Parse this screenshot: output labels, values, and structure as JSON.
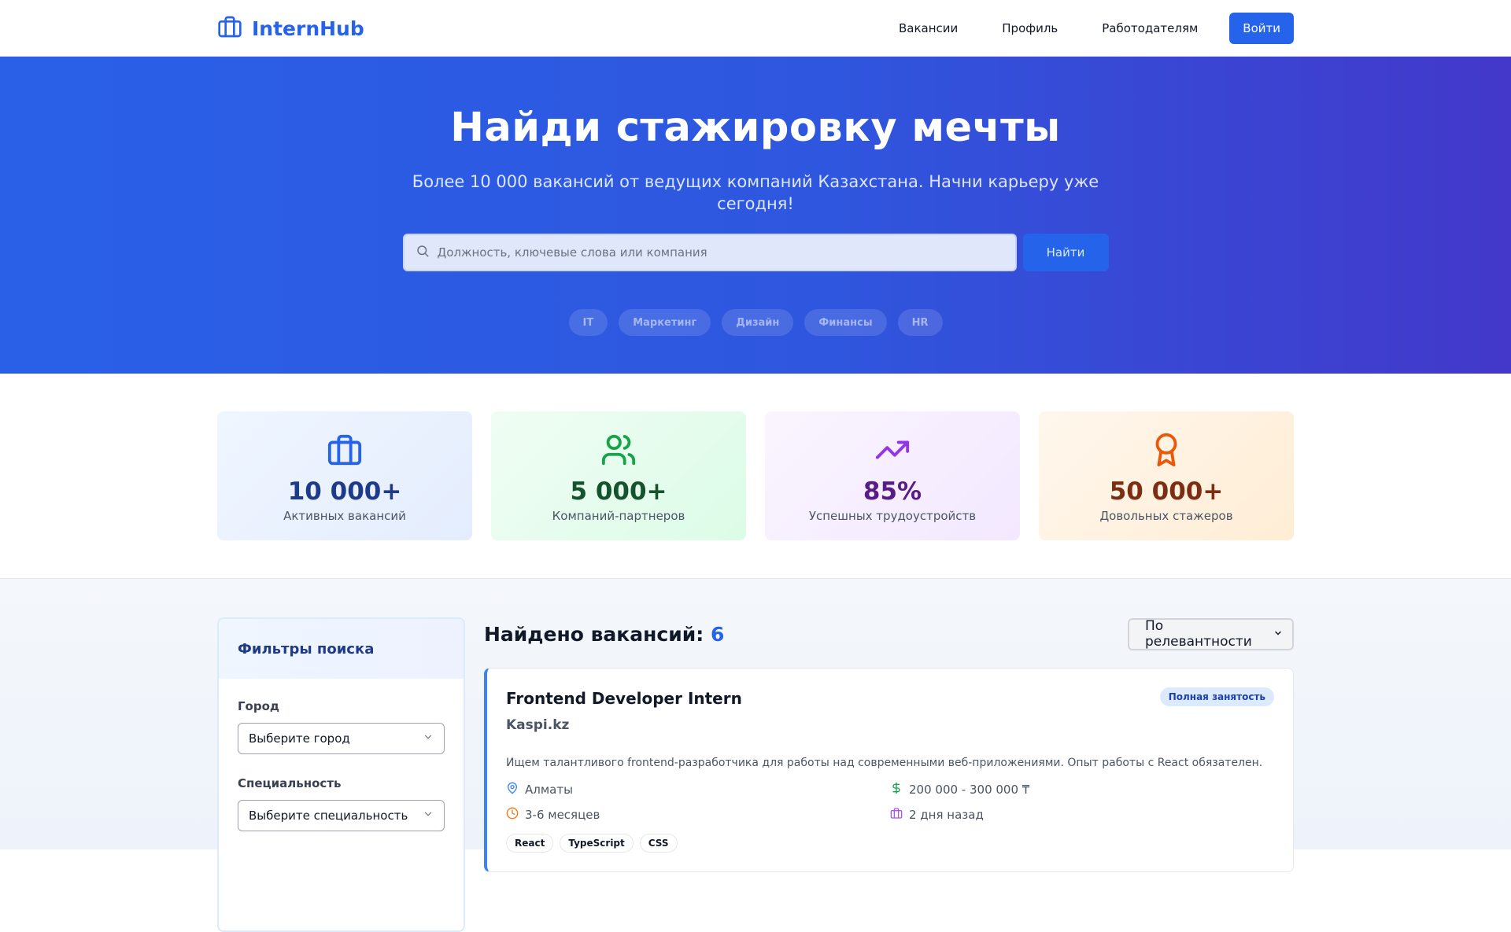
{
  "header": {
    "brand": "InternHub",
    "nav": [
      "Вакансии",
      "Профиль",
      "Работодателям"
    ],
    "login": "Войти"
  },
  "hero": {
    "title": "Найди стажировку мечты",
    "subtitle": "Более 10 000 вакансий от ведущих компаний Казахстана. Начни карьеру уже сегодня!",
    "search_placeholder": "Должность, ключевые слова или компания",
    "search_button": "Найти",
    "chips": [
      "IT",
      "Маркетинг",
      "Дизайн",
      "Финансы",
      "HR"
    ]
  },
  "stats": [
    {
      "value": "10 000+",
      "label": "Активных вакансий",
      "icon": "briefcase-icon",
      "color": "#2563eb"
    },
    {
      "value": "5 000+",
      "label": "Компаний-партнеров",
      "icon": "users-icon",
      "color": "#16a34a"
    },
    {
      "value": "85%",
      "label": "Успешных трудоустройств",
      "icon": "trending-up-icon",
      "color": "#9333ea"
    },
    {
      "value": "50 000+",
      "label": "Довольных стажеров",
      "icon": "award-icon",
      "color": "#ea580c"
    }
  ],
  "filters": {
    "title": "Фильтры поиска",
    "city_label": "Город",
    "city_value": "Выберите город",
    "spec_label": "Специальность",
    "spec_value": "Выберите специальность"
  },
  "results": {
    "title": "Найдено вакансий:",
    "count": "6",
    "sort": "По релевантности"
  },
  "job": {
    "title": "Frontend Developer Intern",
    "company": "Kaspi.kz",
    "badge": "Полная занятость",
    "description": "Ищем талантливого frontend-разработчика для работы над современными веб-приложениями. Опыт работы с React обязателен.",
    "location": "Алматы",
    "salary": "200 000 - 300 000 ₸",
    "duration": "3-6 месяцев",
    "posted": "2 дня назад",
    "tags": [
      "React",
      "TypeScript",
      "CSS"
    ]
  }
}
